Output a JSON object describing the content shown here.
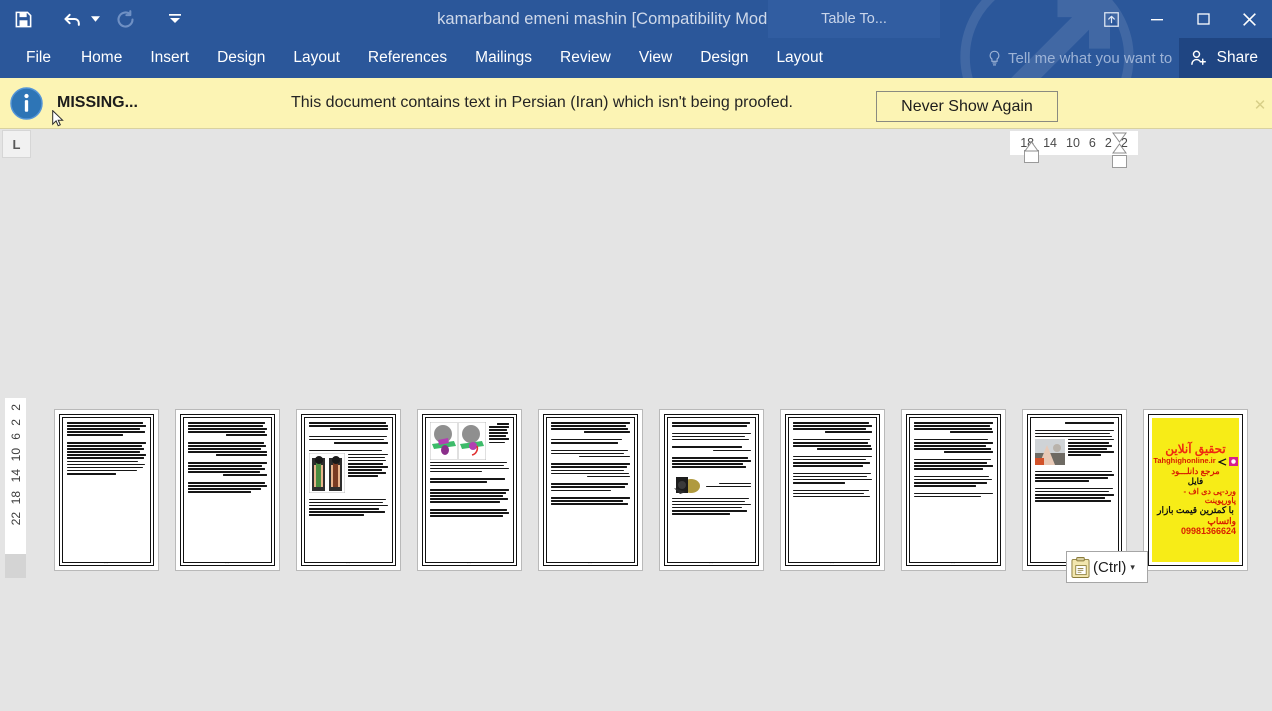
{
  "window": {
    "title": "kamarband emeni mashin [Compatibility Mode] - Word",
    "contextual_tab_title": "Table To...",
    "accent_color": "#2b579a",
    "controls": {
      "ribbon_display_options": "ribbon-display-options-icon",
      "minimize": "–",
      "restore": "❐",
      "close": "✕"
    }
  },
  "quick_access": {
    "save": "save-icon",
    "undo": "undo-icon",
    "undo_dropdown": "▾",
    "redo": "redo-icon",
    "customize": "customize-qat-icon"
  },
  "ribbon": {
    "tabs": [
      {
        "label": "File",
        "active": false
      },
      {
        "label": "Home",
        "active": false
      },
      {
        "label": "Insert",
        "active": false
      },
      {
        "label": "Design",
        "active": false
      },
      {
        "label": "Layout",
        "active": false
      },
      {
        "label": "References",
        "active": false
      },
      {
        "label": "Mailings",
        "active": false
      },
      {
        "label": "Review",
        "active": false
      },
      {
        "label": "View",
        "active": false
      }
    ],
    "contextual_tabs": [
      {
        "label": "Design"
      },
      {
        "label": "Layout"
      }
    ],
    "tell_me": "Tell me what you want to",
    "share": "Share"
  },
  "message_bar": {
    "icon": "info-icon",
    "missing_label": "MISSING...",
    "message": "This document contains text in Persian (Iran) which isn't being proofed.",
    "button": "Never Show Again",
    "close": "✕",
    "background": "#fcf4b4"
  },
  "rulers": {
    "tab_selector": "L",
    "horizontal_ticks": [
      "18",
      "14",
      "10",
      "6",
      "2",
      "2"
    ],
    "vertical_ticks": [
      "2",
      "2",
      "6",
      "10",
      "14",
      "18",
      "22"
    ]
  },
  "document": {
    "page_count": 10,
    "pages": [
      {
        "number": 1,
        "has_image": false,
        "image_kind": "none"
      },
      {
        "number": 2,
        "has_image": false,
        "image_kind": "none"
      },
      {
        "number": 3,
        "has_image": true,
        "image_kind": "seatbelt-photo"
      },
      {
        "number": 4,
        "has_image": true,
        "image_kind": "diagram-pair"
      },
      {
        "number": 5,
        "has_image": false,
        "image_kind": "none"
      },
      {
        "number": 6,
        "has_image": true,
        "image_kind": "mechanism-photo"
      },
      {
        "number": 7,
        "has_image": false,
        "image_kind": "none"
      },
      {
        "number": 8,
        "has_image": false,
        "image_kind": "none"
      },
      {
        "number": 9,
        "has_image": true,
        "image_kind": "person-photo"
      },
      {
        "number": 10,
        "has_image": false,
        "image_kind": "advertisement"
      }
    ],
    "ad_page": {
      "headline": "تحقیق آنلاین",
      "site": "Tahghighonline.ir",
      "line1": "مرجع دانلـــود",
      "line2": "فایل",
      "line3": "ورد-پی دی اف - پاورپوینت",
      "line4": "با کمترین قیمت بازار",
      "line5": "واتساپ 09981366624",
      "background": "#f7ec17"
    }
  },
  "paste_options": {
    "icon": "clipboard-icon",
    "label": "(Ctrl)",
    "caret": "▾"
  }
}
